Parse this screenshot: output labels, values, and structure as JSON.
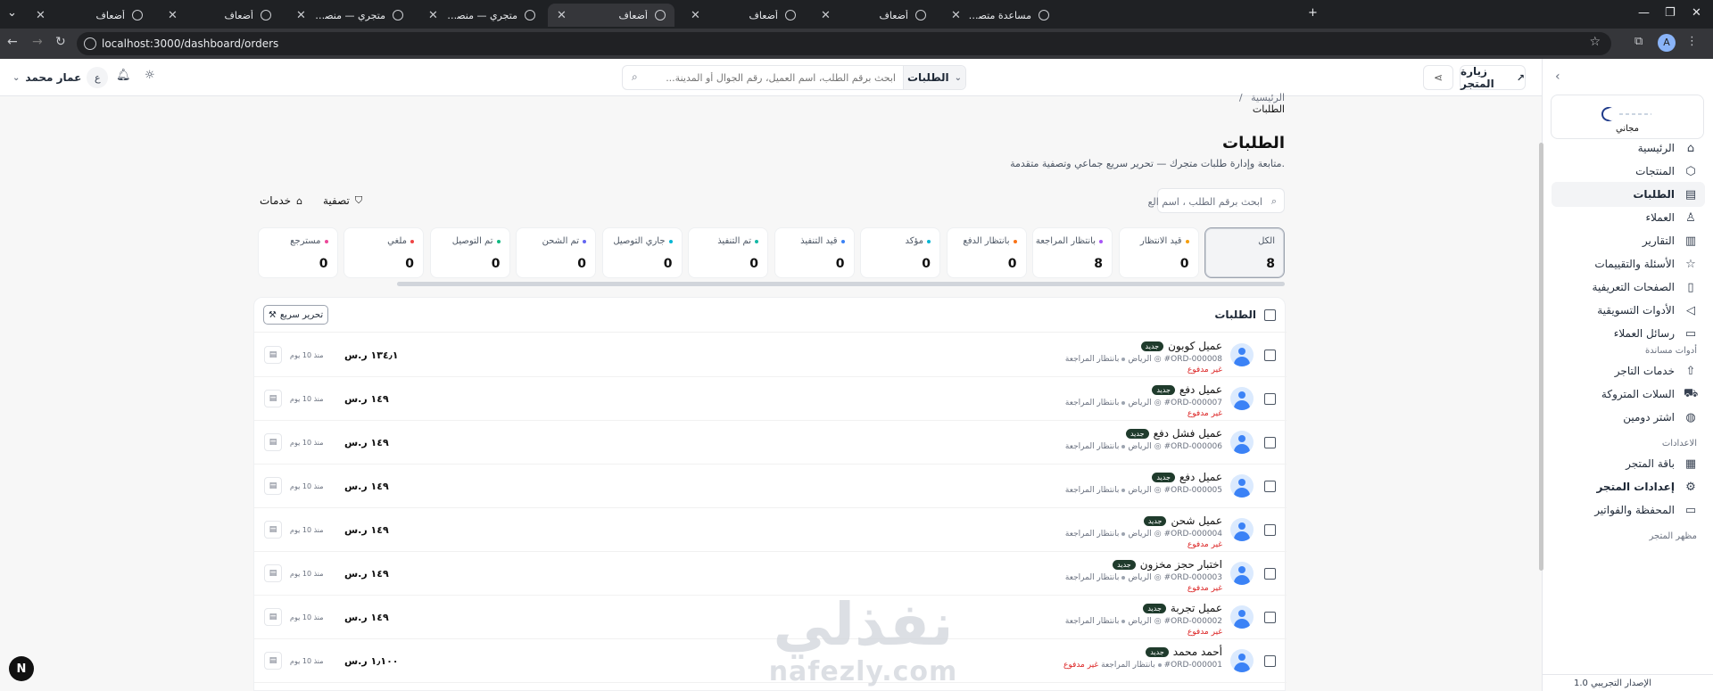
{
  "browser": {
    "tabs": [
      {
        "title": "أضعاف",
        "active": false
      },
      {
        "title": "أضعاف",
        "active": false
      },
      {
        "title": "متجري — منصة المتاجر الإلكترونية",
        "active": false
      },
      {
        "title": "متجري — منصة المتاجر الإلكترونية",
        "active": false
      },
      {
        "title": "أضعاف",
        "active": true
      },
      {
        "title": "أضعاف",
        "active": false
      },
      {
        "title": "أضعاف",
        "active": false
      },
      {
        "title": "مساعدة متصفح Google Chrome",
        "active": false
      }
    ],
    "url": "localhost:3000/dashboard/orders",
    "profile_initial": "A"
  },
  "topbar": {
    "visit_store": "زيارة المتجر",
    "search_scope": "الطلبات",
    "search_placeholder": "ابحث برقم الطلب، اسم العميل، رقم الجوال أو المدينة...",
    "user_name": "عمار محمد",
    "user_initial": "ع"
  },
  "sidebar": {
    "plan": "مجاني",
    "items": [
      {
        "label": "الرئيسية",
        "icon": "home-icon",
        "glyph": "⌂"
      },
      {
        "label": "المنتجات",
        "icon": "box-icon",
        "glyph": "⬡"
      },
      {
        "label": "الطلبات",
        "icon": "clipboard-icon",
        "glyph": "▤",
        "active": true
      },
      {
        "label": "العملاء",
        "icon": "user-icon",
        "glyph": "♙"
      },
      {
        "label": "التقارير",
        "icon": "chart-icon",
        "glyph": "▥"
      },
      {
        "label": "الأسئلة والتقييمات",
        "icon": "star-icon",
        "glyph": "☆"
      },
      {
        "label": "الصفحات التعريفية",
        "icon": "page-icon",
        "glyph": "▯"
      },
      {
        "label": "الأدوات التسويقية",
        "icon": "megaphone-icon",
        "glyph": "◁"
      },
      {
        "label": "رسائل العملاء",
        "icon": "message-icon",
        "glyph": "▭"
      }
    ],
    "section_tools": "أدوات مساندة",
    "tools": [
      {
        "label": "خدمات التاجر",
        "icon": "upload-icon",
        "glyph": "⇧"
      },
      {
        "label": "السلات المتروكة",
        "icon": "cart-icon",
        "glyph": "⛟"
      },
      {
        "label": "اشتر دومين",
        "icon": "globe-icon",
        "glyph": "◍"
      }
    ],
    "section_settings": "الاعدادات",
    "settings": [
      {
        "label": "باقة المتجر",
        "icon": "package-icon",
        "glyph": "▦"
      },
      {
        "label": "إعدادات المتجر",
        "icon": "gear-icon",
        "glyph": "⚙",
        "highlight": true
      },
      {
        "label": "المحفظة والفواتير",
        "icon": "wallet-icon",
        "glyph": "▭"
      }
    ],
    "section_appearance": "مظهر المتجر",
    "version": "الإصدار التجريبي 1.0"
  },
  "main": {
    "breadcrumb_home": "الرئيسية",
    "breadcrumb_sep": "/",
    "breadcrumb_current": "الطلبات",
    "title": "الطلبات",
    "subtitle": "متابعة وإدارة طلبات متجرك — تحرير سريع جماعي وتصفية متقدمة.",
    "search_placeholder": "ابحث برقم الطلب ، اسم الع",
    "filter_label": "تصفية",
    "services_label": "خدمات",
    "stats": [
      {
        "label": "الكل",
        "count": "8",
        "color": "",
        "selected": true
      },
      {
        "label": "قيد الانتظار",
        "count": "0",
        "color": "#f59e0b"
      },
      {
        "label": "بانتظار المراجعة",
        "count": "8",
        "color": "#a855f7"
      },
      {
        "label": "بانتظار الدفع",
        "count": "0",
        "color": "#f97316"
      },
      {
        "label": "مؤكد",
        "count": "0",
        "color": "#06b6d4"
      },
      {
        "label": "قيد التنفيذ",
        "count": "0",
        "color": "#3b82f6"
      },
      {
        "label": "تم التنفيذ",
        "count": "0",
        "color": "#14b8a6"
      },
      {
        "label": "جاري التوصيل",
        "count": "0",
        "color": "#06b6d4"
      },
      {
        "label": "تم الشحن",
        "count": "0",
        "color": "#6366f1"
      },
      {
        "label": "تم التوصيل",
        "count": "0",
        "color": "#10b981"
      },
      {
        "label": "ملغي",
        "count": "0",
        "color": "#ef4444"
      },
      {
        "label": "مسترجع",
        "count": "0",
        "color": "#ec4899"
      }
    ],
    "table_title": "الطلبات",
    "quick_edit": "تحرير سريع",
    "orders": [
      {
        "name": "عميل كوبون",
        "badge": "جديد",
        "id": "#ORD-000008",
        "city": "الرياض",
        "status": "بانتظار المراجعة",
        "payment": "غير مدفوع",
        "amount": "١٣٤٫١ ر.س",
        "ago": "منذ 10 يوم"
      },
      {
        "name": "عميل دفع",
        "badge": "جديد",
        "id": "#ORD-000007",
        "city": "الرياض",
        "status": "بانتظار المراجعة",
        "payment": "غير مدفوع",
        "amount": "١٤٩ ر.س",
        "ago": "منذ 10 يوم"
      },
      {
        "name": "عميل فشل دفع",
        "badge": "جديد",
        "id": "#ORD-000006",
        "city": "الرياض",
        "status": "بانتظار المراجعة",
        "payment": "",
        "amount": "١٤٩ ر.س",
        "ago": "منذ 10 يوم"
      },
      {
        "name": "عميل دفع",
        "badge": "جديد",
        "id": "#ORD-000005",
        "city": "الرياض",
        "status": "بانتظار المراجعة",
        "payment": "",
        "amount": "١٤٩ ر.س",
        "ago": "منذ 10 يوم"
      },
      {
        "name": "عميل شحن",
        "badge": "جديد",
        "id": "#ORD-000004",
        "city": "الرياض",
        "status": "بانتظار المراجعة",
        "payment": "غير مدفوع",
        "amount": "١٤٩ ر.س",
        "ago": "منذ 10 يوم"
      },
      {
        "name": "اختبار حجز مخزون",
        "badge": "جديد",
        "id": "#ORD-000003",
        "city": "الرياض",
        "status": "بانتظار المراجعة",
        "payment": "غير مدفوع",
        "amount": "١٤٩ ر.س",
        "ago": "منذ 10 يوم"
      },
      {
        "name": "عميل تجربة",
        "badge": "جديد",
        "id": "#ORD-000002",
        "city": "الرياض",
        "status": "بانتظار المراجعة",
        "payment": "غير مدفوع",
        "amount": "١٤٩ ر.س",
        "ago": "منذ 10 يوم"
      },
      {
        "name": "أحمد محمد",
        "badge": "جديد",
        "id": "#ORD-000001",
        "city": "",
        "status": "بانتظار المراجعة",
        "payment": "غير مدفوع",
        "amount": "١٫١٠٠ ر.س",
        "ago": "منذ 10 يوم",
        "payment_inline": true
      }
    ]
  },
  "watermark": {
    "arabic": "نفذلي",
    "latin": "nafezly.com"
  },
  "floating": {
    "initial": "N"
  }
}
